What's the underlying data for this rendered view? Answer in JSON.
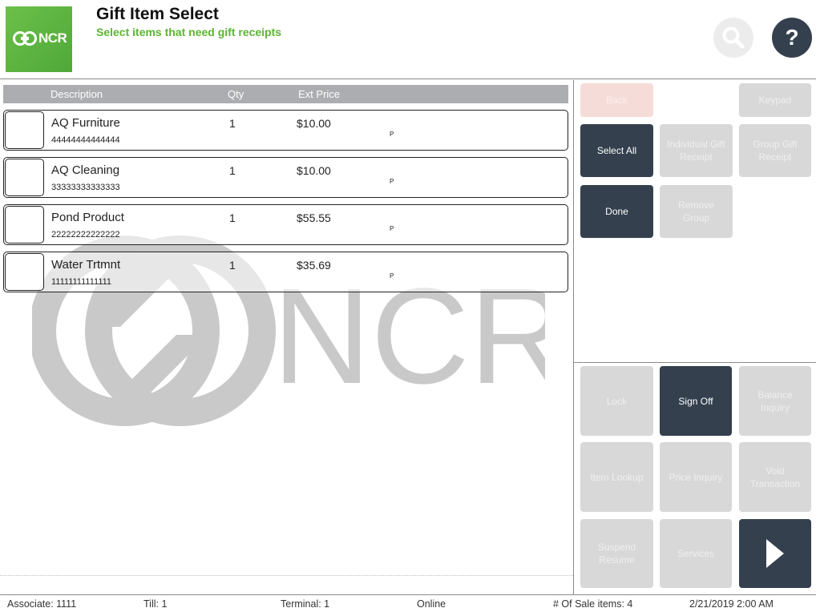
{
  "header": {
    "logo_text": "NCR",
    "title": "Gift Item Select",
    "subtitle": "Select items that need gift receipts",
    "search_icon": "search-icon",
    "help_label": "?"
  },
  "watermark": {
    "text": "NCR"
  },
  "list": {
    "columns": {
      "description": "Description",
      "qty": "Qty",
      "ext_price": "Ext Price"
    },
    "items": [
      {
        "description": "AQ Furniture",
        "code": "44444444444444",
        "qty": "1",
        "price": "$10.00",
        "flag": "P"
      },
      {
        "description": "AQ Cleaning",
        "code": "33333333333333",
        "qty": "1",
        "price": "$10.00",
        "flag": "P"
      },
      {
        "description": "Pond Product",
        "code": "22222222222222",
        "qty": "1",
        "price": "$55.55",
        "flag": "P"
      },
      {
        "description": "Water Trtmnt",
        "code": "11111111111111",
        "qty": "1",
        "price": "$35.69",
        "flag": "P"
      }
    ]
  },
  "actions": {
    "back": "Back",
    "keypad": "Keypad",
    "select_all": "Select All",
    "individual_gift_receipt": "Individual Gift Receipt",
    "group_gift_receipt": "Group Gift Receipt",
    "done": "Done",
    "remove_group": "Remove Group"
  },
  "functions": {
    "lock": "Lock",
    "sign_off": "Sign Off",
    "balance_inquiry": "Balance Inquiry",
    "item_lookup": "Item Lookup",
    "price_inquiry": "Price Inquiry",
    "void_transaction": "Void Transaction",
    "suspend_resume": "Suspend Resume",
    "services": "Services",
    "next_icon": "chevron-right-icon"
  },
  "status": {
    "associate": "Associate: 1111",
    "till": "Till: 1",
    "terminal": "Terminal: 1",
    "online": "Online",
    "sale_items": "# Of Sale items: 4",
    "datetime": "2/21/2019 2:00 AM"
  },
  "colors": {
    "brand_green": "#5cb531",
    "dark_button": "#34404e",
    "disabled_button": "#d8d8d8",
    "header_bar": "#abadb0"
  }
}
